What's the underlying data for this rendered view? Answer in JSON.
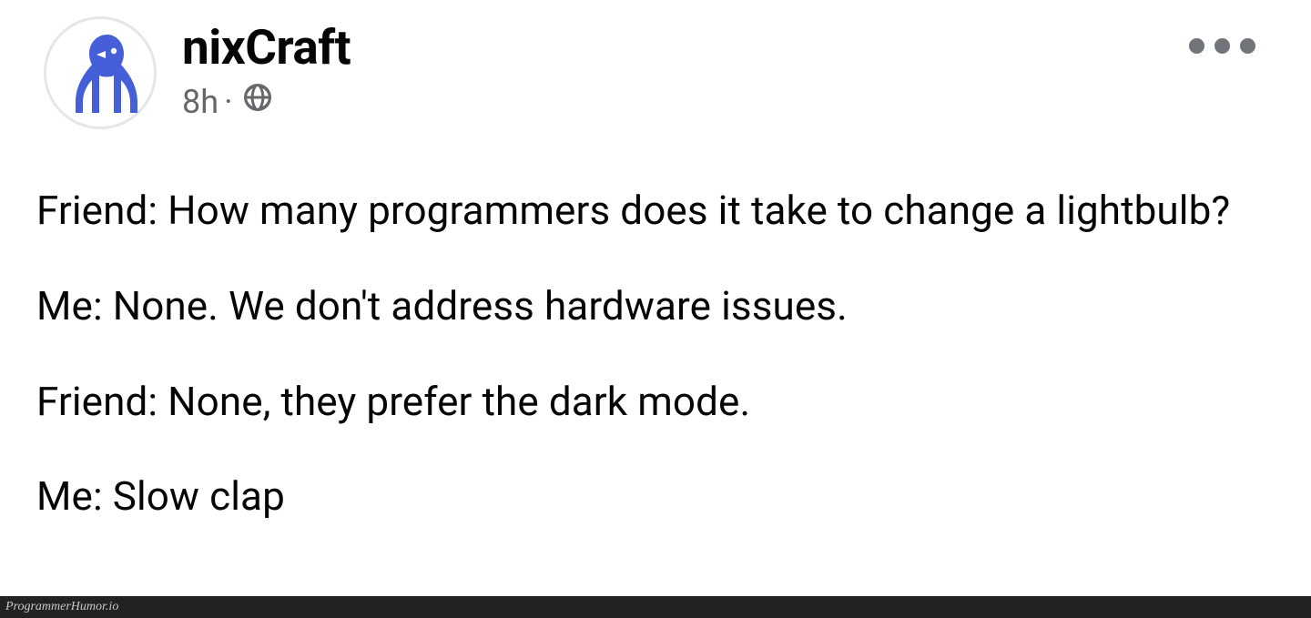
{
  "post": {
    "author": "nixCraft",
    "timestamp": "8h",
    "privacy": "Public",
    "lines": [
      "Friend: How many programmers does it take to change a lightbulb?",
      "Me: None. We don't address hardware issues.",
      "Friend: None, they prefer the dark mode.",
      "Me: Slow clap"
    ]
  },
  "footer": {
    "watermark": "ProgrammerHumor.io"
  },
  "colors": {
    "text": "#050505",
    "secondary": "#65676b",
    "avatar_blue": "#455fd9"
  }
}
